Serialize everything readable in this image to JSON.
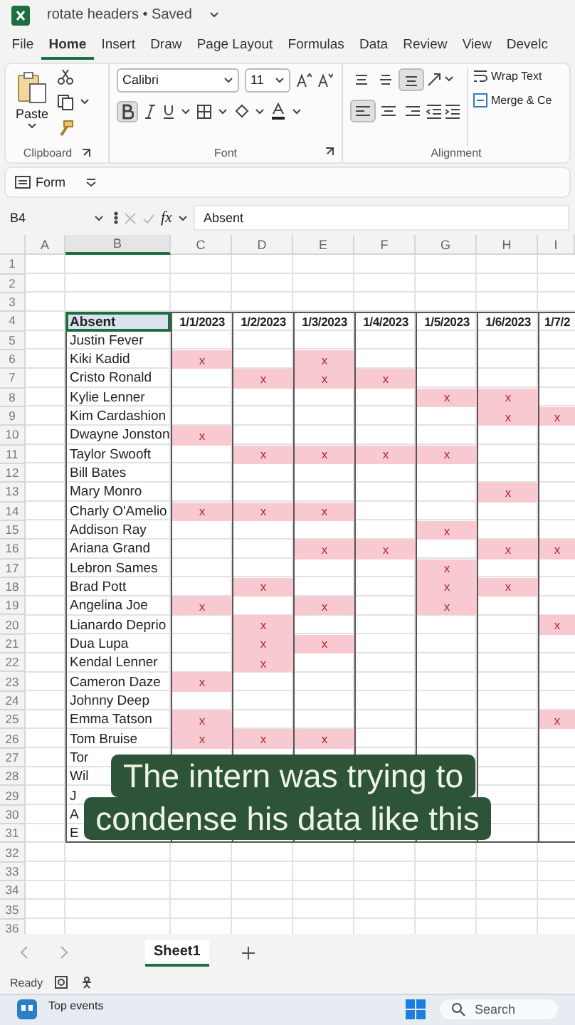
{
  "window": {
    "title": "rotate headers • Saved"
  },
  "tabs": [
    {
      "label": "File",
      "selected": false
    },
    {
      "label": "Home",
      "selected": true
    },
    {
      "label": "Insert",
      "selected": false
    },
    {
      "label": "Draw",
      "selected": false
    },
    {
      "label": "Page Layout",
      "selected": false
    },
    {
      "label": "Formulas",
      "selected": false
    },
    {
      "label": "Data",
      "selected": false
    },
    {
      "label": "Review",
      "selected": false
    },
    {
      "label": "View",
      "selected": false
    },
    {
      "label": "Develc",
      "selected": false
    }
  ],
  "ribbon": {
    "clipboard": {
      "paste_label": "Paste",
      "group_label": "Clipboard"
    },
    "font": {
      "name": "Calibri",
      "size": "11",
      "bold": true,
      "group_label": "Font"
    },
    "alignment": {
      "vertical": [
        {
          "kind": "top",
          "selected": false
        },
        {
          "kind": "middle",
          "selected": false
        },
        {
          "kind": "bottom",
          "selected": true
        }
      ],
      "horizontal": [
        {
          "kind": "left",
          "selected": true
        },
        {
          "kind": "center",
          "selected": false
        },
        {
          "kind": "right",
          "selected": false
        }
      ],
      "wrap_label": "Wrap Text",
      "merge_label": "Merge & Ce",
      "group_label": "Alignment"
    }
  },
  "quick_bar": {
    "label": "Form"
  },
  "formula_bar": {
    "name_box": "B4",
    "fx": "fx",
    "value": "Absent"
  },
  "sheet": {
    "column_headers": [
      "A",
      "B",
      "C",
      "D",
      "E",
      "F",
      "G",
      "H",
      "I"
    ],
    "row_numbers": [
      "1",
      "2",
      "3",
      "4",
      "5",
      "6",
      "7",
      "8",
      "9",
      "10",
      "11",
      "12",
      "13",
      "14",
      "15",
      "16",
      "17",
      "18",
      "19",
      "20",
      "21",
      "22",
      "23",
      "24",
      "25",
      "26",
      "27",
      "28",
      "29",
      "30",
      "31",
      "32",
      "33",
      "34",
      "35",
      "36"
    ],
    "header": {
      "label": "Absent",
      "selected": true,
      "dates": [
        "1/1/2023",
        "1/2/2023",
        "1/3/2023",
        "1/4/2023",
        "1/5/2023",
        "1/6/2023",
        "1/7/2"
      ]
    },
    "rows": [
      {
        "name": "Justin Fever",
        "cells": [
          {
            "absent": false
          },
          {
            "absent": false
          },
          {
            "absent": false
          },
          {
            "absent": false
          },
          {
            "absent": false
          },
          {
            "absent": false
          },
          {
            "absent": false
          }
        ]
      },
      {
        "name": "Kiki Kadid",
        "cells": [
          {
            "absent": true,
            "text": "x"
          },
          {
            "absent": false
          },
          {
            "absent": true,
            "text": "x"
          },
          {
            "absent": false
          },
          {
            "absent": false
          },
          {
            "absent": false
          },
          {
            "absent": false
          }
        ]
      },
      {
        "name": "Cristo Ronald",
        "cells": [
          {
            "absent": false
          },
          {
            "absent": true,
            "text": "x"
          },
          {
            "absent": true,
            "text": "x"
          },
          {
            "absent": true,
            "text": "x"
          },
          {
            "absent": false
          },
          {
            "absent": false
          },
          {
            "absent": false
          }
        ]
      },
      {
        "name": "Kylie Lenner",
        "cells": [
          {
            "absent": false
          },
          {
            "absent": false
          },
          {
            "absent": false
          },
          {
            "absent": false
          },
          {
            "absent": true,
            "text": "x"
          },
          {
            "absent": true,
            "text": "x"
          },
          {
            "absent": false
          }
        ]
      },
      {
        "name": "Kim Cardashion",
        "cells": [
          {
            "absent": false
          },
          {
            "absent": false
          },
          {
            "absent": false
          },
          {
            "absent": false
          },
          {
            "absent": false
          },
          {
            "absent": true,
            "text": "x"
          },
          {
            "absent": true,
            "text": "x"
          }
        ]
      },
      {
        "name": "Dwayne Jonston",
        "cells": [
          {
            "absent": true,
            "text": "x"
          },
          {
            "absent": false
          },
          {
            "absent": false
          },
          {
            "absent": false
          },
          {
            "absent": false
          },
          {
            "absent": false
          },
          {
            "absent": false
          }
        ]
      },
      {
        "name": "Taylor Swooft",
        "cells": [
          {
            "absent": false
          },
          {
            "absent": true,
            "text": "x"
          },
          {
            "absent": true,
            "text": "x"
          },
          {
            "absent": true,
            "text": "x"
          },
          {
            "absent": true,
            "text": "x"
          },
          {
            "absent": false
          },
          {
            "absent": false
          }
        ]
      },
      {
        "name": "Bill Bates",
        "cells": [
          {
            "absent": false
          },
          {
            "absent": false
          },
          {
            "absent": false
          },
          {
            "absent": false
          },
          {
            "absent": false
          },
          {
            "absent": false
          },
          {
            "absent": false
          }
        ]
      },
      {
        "name": "Mary Monro",
        "cells": [
          {
            "absent": false
          },
          {
            "absent": false
          },
          {
            "absent": false
          },
          {
            "absent": false
          },
          {
            "absent": false
          },
          {
            "absent": true,
            "text": "x"
          },
          {
            "absent": false
          }
        ]
      },
      {
        "name": "Charly O'Amelio",
        "cells": [
          {
            "absent": true,
            "text": "x"
          },
          {
            "absent": true,
            "text": "x"
          },
          {
            "absent": true,
            "text": "x"
          },
          {
            "absent": false
          },
          {
            "absent": false
          },
          {
            "absent": false
          },
          {
            "absent": false
          }
        ]
      },
      {
        "name": "Addison Ray",
        "cells": [
          {
            "absent": false
          },
          {
            "absent": false
          },
          {
            "absent": false
          },
          {
            "absent": false
          },
          {
            "absent": true,
            "text": "x"
          },
          {
            "absent": false
          },
          {
            "absent": false
          }
        ]
      },
      {
        "name": "Ariana Grand",
        "cells": [
          {
            "absent": false
          },
          {
            "absent": false
          },
          {
            "absent": true,
            "text": "x"
          },
          {
            "absent": true,
            "text": "x"
          },
          {
            "absent": false
          },
          {
            "absent": true,
            "text": "x"
          },
          {
            "absent": true,
            "text": "x"
          }
        ]
      },
      {
        "name": "Lebron Sames",
        "cells": [
          {
            "absent": false
          },
          {
            "absent": false
          },
          {
            "absent": false
          },
          {
            "absent": false
          },
          {
            "absent": true,
            "text": "x"
          },
          {
            "absent": false
          },
          {
            "absent": false
          }
        ]
      },
      {
        "name": "Brad Pott",
        "cells": [
          {
            "absent": false
          },
          {
            "absent": true,
            "text": "x"
          },
          {
            "absent": false
          },
          {
            "absent": false
          },
          {
            "absent": true,
            "text": "x"
          },
          {
            "absent": true,
            "text": "x"
          },
          {
            "absent": false
          }
        ]
      },
      {
        "name": "Angelina Joe",
        "cells": [
          {
            "absent": true,
            "text": "x"
          },
          {
            "absent": false
          },
          {
            "absent": true,
            "text": "x"
          },
          {
            "absent": false
          },
          {
            "absent": true,
            "text": "x"
          },
          {
            "absent": false
          },
          {
            "absent": false
          }
        ]
      },
      {
        "name": "Lianardo Deprio",
        "cells": [
          {
            "absent": false
          },
          {
            "absent": true,
            "text": "x"
          },
          {
            "absent": false
          },
          {
            "absent": false
          },
          {
            "absent": false
          },
          {
            "absent": false
          },
          {
            "absent": true,
            "text": "x"
          }
        ]
      },
      {
        "name": "Dua Lupa",
        "cells": [
          {
            "absent": false
          },
          {
            "absent": true,
            "text": "x"
          },
          {
            "absent": true,
            "text": "x"
          },
          {
            "absent": false
          },
          {
            "absent": false
          },
          {
            "absent": false
          },
          {
            "absent": false
          }
        ]
      },
      {
        "name": "Kendal Lenner",
        "cells": [
          {
            "absent": false
          },
          {
            "absent": true,
            "text": "x"
          },
          {
            "absent": false
          },
          {
            "absent": false
          },
          {
            "absent": false
          },
          {
            "absent": false
          },
          {
            "absent": false
          }
        ]
      },
      {
        "name": "Cameron Daze",
        "cells": [
          {
            "absent": true,
            "text": "x"
          },
          {
            "absent": false
          },
          {
            "absent": false
          },
          {
            "absent": false
          },
          {
            "absent": false
          },
          {
            "absent": false
          },
          {
            "absent": false
          }
        ]
      },
      {
        "name": "Johnny Deep",
        "cells": [
          {
            "absent": false
          },
          {
            "absent": false
          },
          {
            "absent": false
          },
          {
            "absent": false
          },
          {
            "absent": false
          },
          {
            "absent": false
          },
          {
            "absent": false
          }
        ]
      },
      {
        "name": "Emma Tatson",
        "cells": [
          {
            "absent": true,
            "text": "x"
          },
          {
            "absent": false
          },
          {
            "absent": false
          },
          {
            "absent": false
          },
          {
            "absent": false
          },
          {
            "absent": false
          },
          {
            "absent": true,
            "text": "x"
          }
        ]
      },
      {
        "name": "Tom Bruise",
        "cells": [
          {
            "absent": true,
            "text": "x"
          },
          {
            "absent": true,
            "text": "x"
          },
          {
            "absent": true,
            "text": "x"
          },
          {
            "absent": false
          },
          {
            "absent": false
          },
          {
            "absent": false
          },
          {
            "absent": false
          }
        ]
      }
    ],
    "covered_rows": [
      "Tor",
      "Wil",
      "J",
      "A",
      "E"
    ]
  },
  "caption": {
    "lines": [
      "The intern was trying to",
      "condense his data like this"
    ]
  },
  "sheet_tabs": [
    {
      "label": "Sheet1",
      "selected": true
    }
  ],
  "status_bar": {
    "text": "Ready"
  },
  "taskbar": {
    "widget_title": "Top events",
    "search_placeholder": "Search"
  }
}
